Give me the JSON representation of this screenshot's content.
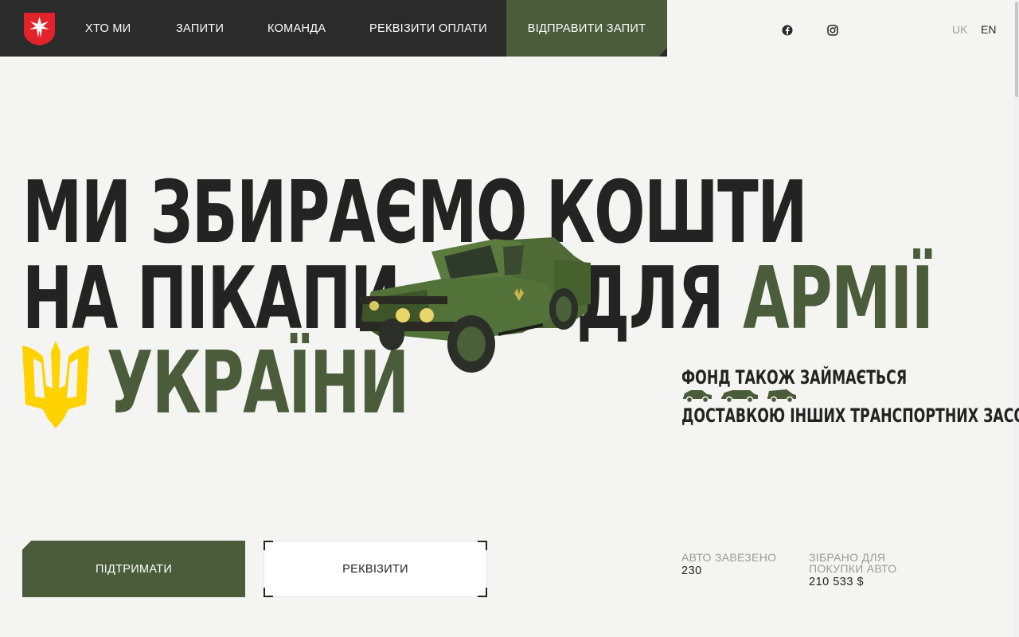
{
  "header": {
    "nav": [
      {
        "label": "ХТО МИ"
      },
      {
        "label": "ЗАПИТИ"
      },
      {
        "label": "КОМАНДА"
      },
      {
        "label": "РЕКВІЗИТИ ОПЛАТИ"
      }
    ],
    "cta_label": "ВІДПРАВИТИ ЗАПИТ",
    "social": [
      "facebook-icon",
      "instagram-icon"
    ],
    "languages": [
      {
        "code": "UK",
        "active": true
      },
      {
        "code": "EN",
        "active": false
      }
    ]
  },
  "hero": {
    "line1": "МИ ЗБИРАЄМО КОШТИ",
    "line2_left": "НА ПІКАПИ",
    "line2_right_dark": "ДЛЯ",
    "line2_right_accent": "АРМІЇ",
    "line3": "УКРАЇНИ"
  },
  "side_note": {
    "line1": "ФОНД ТАКОЖ ЗАЙМАЄТЬСЯ",
    "line2": "ДОСТАВКОЮ ІНШИХ ТРАНСПОРТНИХ ЗАСОБІВ",
    "icons": [
      "car-icon",
      "van-icon",
      "minivan-icon"
    ]
  },
  "actions": {
    "support_label": "ПІДТРИМАТИ",
    "details_label": "РЕКВІЗИТИ"
  },
  "stats": {
    "cars_label": "АВТО ЗАВЕЗЕНО",
    "cars_value": "230",
    "raised_label_1": "ЗІБРАНО ДЛЯ",
    "raised_label_2": "ПОКУПКИ АВТО",
    "raised_value": "210 533 $"
  },
  "colors": {
    "accent_green": "#4a5c3a",
    "dark": "#2b2b2b",
    "trident_yellow": "#ffd200",
    "logo_red": "#e3232c"
  }
}
